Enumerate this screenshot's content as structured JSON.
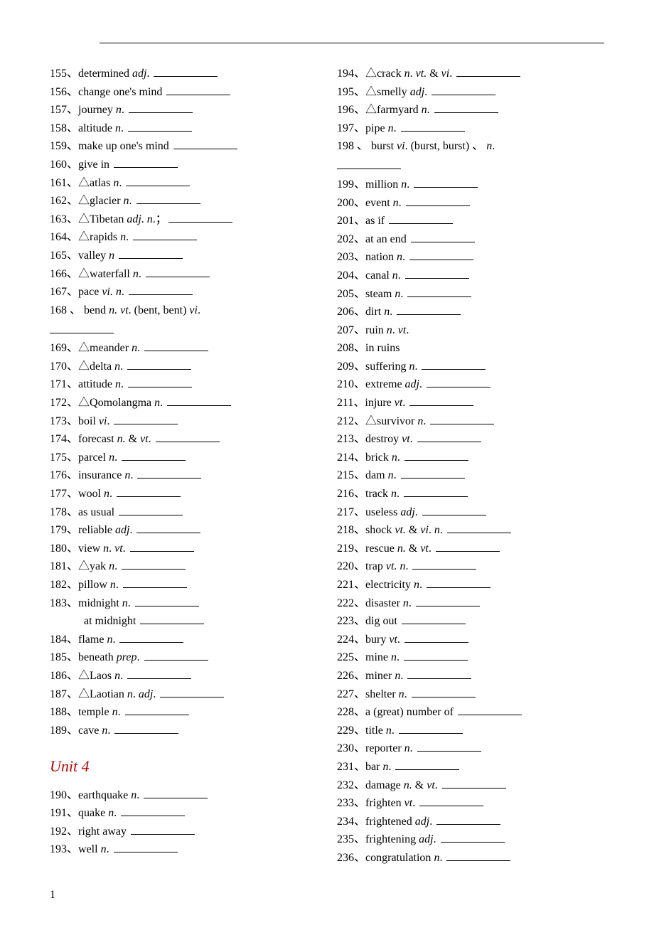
{
  "page_number": "1",
  "unit_header": "Unit 4",
  "left_col": [
    {
      "n": "155、",
      "pre": "determined ",
      "it": "adj",
      "post": ". ",
      "blank": true
    },
    {
      "n": "156、",
      "pre": "change one's mind ",
      "blank": true
    },
    {
      "n": "157、",
      "pre": "journey ",
      "it": "n",
      "post": ". ",
      "blank": true
    },
    {
      "n": "158、",
      "pre": "altitude ",
      "it": "n",
      "post": ". ",
      "blank": true
    },
    {
      "n": "159、",
      "pre": "make up one's mind ",
      "blank": true
    },
    {
      "n": "160、",
      "pre": "give in ",
      "blank": true
    },
    {
      "n": "161、",
      "pre": "△atlas ",
      "it": "n",
      "post": ". ",
      "blank": true
    },
    {
      "n": "162、",
      "pre": "△glacier ",
      "it": "n",
      "post": ". ",
      "blank": true
    },
    {
      "n": "163、",
      "pre": "△Tibetan    ",
      "it": "adj",
      "post": ".      ",
      "it2": "n",
      "post2": ".；",
      "blank": true
    },
    {
      "n": "164、",
      "pre": "△rapids ",
      "it": "n",
      "post": ". ",
      "blank": true
    },
    {
      "n": "165、",
      "pre": "valley ",
      "it": "n",
      "post": " ",
      "blank": true
    },
    {
      "n": "166、",
      "pre": "△waterfall ",
      "it": "n",
      "post": ". ",
      "blank": true
    },
    {
      "n": "167、",
      "pre": "pace ",
      "it": "vi. n",
      "post": ". ",
      "blank": true
    },
    {
      "n": "168 、 ",
      "pre": "bend  ",
      "it": "n.  vt",
      "post": ".  (bent,  bent)     ",
      "it2": "vi",
      "post2": ".",
      "blank": false,
      "cont": true
    },
    {
      "n": "169、",
      "pre": "△meander ",
      "it": "n",
      "post": ". ",
      "blank": true
    },
    {
      "n": "170、",
      "pre": "△delta ",
      "it": "n",
      "post": ". ",
      "blank": true
    },
    {
      "n": "171、",
      "pre": "attitude ",
      "it": "n",
      "post": ". ",
      "blank": true
    },
    {
      "n": "172、",
      "pre": "△Qomolangma ",
      "it": "n",
      "post": ". ",
      "blank": true
    },
    {
      "n": "173、",
      "pre": "boil ",
      "it": "vi",
      "post": ". ",
      "blank": true
    },
    {
      "n": "174、",
      "pre": "forecast ",
      "it": "n. ",
      "post": "& ",
      "it2": "vt",
      "post2": ". ",
      "blank": true
    },
    {
      "n": "175、",
      "pre": "parcel ",
      "it": "n",
      "post": ". ",
      "blank": true
    },
    {
      "n": "176、",
      "pre": "insurance ",
      "it": "n",
      "post": ". ",
      "blank": true
    },
    {
      "n": "177、",
      "pre": "wool ",
      "it": "n",
      "post": ". ",
      "blank": true
    },
    {
      "n": "178、",
      "pre": "as usual ",
      "blank": true
    },
    {
      "n": "179、",
      "pre": "reliable ",
      "it": "adj",
      "post": ". ",
      "blank": true
    },
    {
      "n": "180、",
      "pre": "view ",
      "it": "n",
      "post": ".    ",
      "it2": "vt",
      "post2": ". ",
      "blank": true
    },
    {
      "n": "181、",
      "pre": "△yak ",
      "it": "n",
      "post": ". ",
      "blank": true
    },
    {
      "n": "182、",
      "pre": "pillow ",
      "it": "n",
      "post": ". ",
      "blank": true
    },
    {
      "n": "183、",
      "pre": "midnight ",
      "it": "n",
      "post": ". ",
      "blank": true
    },
    {
      "sub": true,
      "pre": "at midnight ",
      "blank": true
    },
    {
      "n": "184、",
      "pre": "flame ",
      "it": "n",
      "post": ". ",
      "blank": true
    },
    {
      "n": "185、",
      "pre": "beneath ",
      "it": "prep",
      "post": ". ",
      "blank": true
    },
    {
      "n": "186、",
      "pre": "△Laos ",
      "it": "n",
      "post": ". ",
      "blank": true
    },
    {
      "n": "187、",
      "pre": "△Laotian   ",
      "it": "n",
      "post": ".   ",
      "it2": "adj",
      "post2": ". ",
      "blank": true
    },
    {
      "n": "188、",
      "pre": "temple ",
      "it": "n",
      "post": ". ",
      "blank": true
    },
    {
      "n": "189、",
      "pre": "cave ",
      "it": "n",
      "post": ". ",
      "blank": true
    }
  ],
  "left_col_after_unit": [
    {
      "n": "190、",
      "pre": "earthquake ",
      "it": "n",
      "post": ". ",
      "blank": true
    },
    {
      "n": "191、",
      "pre": "quake ",
      "it": "n",
      "post": ". ",
      "blank": true
    },
    {
      "n": "192、",
      "pre": "right away ",
      "blank": true
    },
    {
      "n": "193、",
      "pre": "well ",
      "it": "n",
      "post": ". ",
      "blank": true
    }
  ],
  "right_col": [
    {
      "n": "194、",
      "pre": "△crack ",
      "it": "n",
      "post": ".   ",
      "it2": "vt. ",
      "post2": "& ",
      "it3": "vi",
      "post3": ". ",
      "blank": true
    },
    {
      "n": "195、",
      "pre": "△smelly ",
      "it": "adj",
      "post": ". ",
      "blank": true
    },
    {
      "n": "196、",
      "pre": "△farmyard ",
      "it": "n",
      "post": ". ",
      "blank": true
    },
    {
      "n": "197、",
      "pre": "pipe ",
      "it": "n",
      "post": ". ",
      "blank": true
    },
    {
      "n": "198 、 ",
      "pre": "burst  ",
      "it": "vi",
      "post": ".  (burst,  burst)   、       ",
      "it2": "n",
      "post2": ".",
      "blank": false,
      "cont": true
    },
    {
      "n": "199、",
      "pre": "million ",
      "it": "n",
      "post": ". ",
      "blank": true
    },
    {
      "n": "200、",
      "pre": "event ",
      "it": "n",
      "post": ". ",
      "blank": true
    },
    {
      "n": "201、",
      "pre": "as if ",
      "blank": true
    },
    {
      "n": "202、",
      "pre": "at an end ",
      "blank": true
    },
    {
      "n": "203、",
      "pre": "nation ",
      "it": "n",
      "post": ". ",
      "blank": true
    },
    {
      "n": "204、",
      "pre": "canal ",
      "it": "n",
      "post": ". ",
      "blank": true
    },
    {
      "n": "205、",
      "pre": "steam ",
      "it": "n",
      "post": ". ",
      "blank": true
    },
    {
      "n": "206、",
      "pre": "dirt ",
      "it": "n",
      "post": ". ",
      "blank": true
    },
    {
      "n": "207、",
      "pre": "ruin ",
      "it": "n",
      "post": ".     ",
      "it2": "vt",
      "post2": ".",
      "blank": false
    },
    {
      "n": "208、",
      "pre": "in ruins",
      "blank": false
    },
    {
      "n": "209、",
      "pre": "suffering ",
      "it": "n",
      "post": ". ",
      "blank": true
    },
    {
      "n": "210、",
      "pre": "extreme ",
      "it": "adj",
      "post": ". ",
      "blank": true
    },
    {
      "n": "211、",
      "pre": "injure   ",
      "it": "vt",
      "post": ". ",
      "blank": true
    },
    {
      "n": "212、",
      "pre": "△survivor ",
      "it": "n",
      "post": ". ",
      "blank": true
    },
    {
      "n": "213、",
      "pre": "destroy   ",
      "it": "vt",
      "post": ". ",
      "blank": true
    },
    {
      "n": "214、",
      "pre": "brick ",
      "it": "n",
      "post": ". ",
      "blank": true
    },
    {
      "n": "215、",
      "pre": "dam ",
      "it": "n",
      "post": ". ",
      "blank": true
    },
    {
      "n": "216、",
      "pre": "track ",
      "it": "n",
      "post": ". ",
      "blank": true
    },
    {
      "n": "217、",
      "pre": "useless ",
      "it": "adj",
      "post": ". ",
      "blank": true
    },
    {
      "n": "218、",
      "pre": "shock   ",
      "it": "vt. ",
      "post": "& ",
      "it2": "vi",
      "post2": ".     ",
      "it3": "n",
      "post3": ". ",
      "blank": true
    },
    {
      "n": "219、",
      "pre": "rescue ",
      "it": "n. ",
      "post": "& ",
      "it2": "vt",
      "post2": ". ",
      "blank": true
    },
    {
      "n": "220、",
      "pre": "trap ",
      "it": "vt. n",
      "post": ". ",
      "blank": true
    },
    {
      "n": "221、",
      "pre": "electricity ",
      "it": "n",
      "post": ". ",
      "blank": true
    },
    {
      "n": "222、",
      "pre": "disaster ",
      "it": "n",
      "post": ". ",
      "blank": true
    },
    {
      "n": "223、",
      "pre": "dig out ",
      "blank": true
    },
    {
      "n": "224、",
      "pre": "bury ",
      "it": "vt",
      "post": ". ",
      "blank": true
    },
    {
      "n": "225、",
      "pre": "mine ",
      "it": "n",
      "post": ". ",
      "blank": true
    },
    {
      "n": "226、",
      "pre": "miner ",
      "it": "n",
      "post": ". ",
      "blank": true
    },
    {
      "n": "227、",
      "pre": "shelter ",
      "it": "n",
      "post": ". ",
      "blank": true
    },
    {
      "n": "228、",
      "pre": "a (great) number of ",
      "blank": true
    },
    {
      "n": "229、",
      "pre": "title ",
      "it": "n",
      "post": ". ",
      "blank": true
    },
    {
      "n": "230、",
      "pre": "reporter ",
      "it": "n",
      "post": ". ",
      "blank": true
    },
    {
      "n": "231、",
      "pre": "bar ",
      "it": "n",
      "post": ". ",
      "blank": true
    },
    {
      "n": "232、",
      "pre": "damage ",
      "it": "n. ",
      "post": "& ",
      "it2": "vt",
      "post2": ". ",
      "blank": true
    },
    {
      "n": "233、",
      "pre": "frighten ",
      "it": "vt",
      "post": ". ",
      "blank": true
    },
    {
      "n": "234、",
      "pre": "frightened ",
      "it": "adj",
      "post": ". ",
      "blank": true
    },
    {
      "n": "235、",
      "pre": "frightening ",
      "it": "adj",
      "post": ". ",
      "blank": true
    },
    {
      "n": "236、",
      "pre": "congratulation ",
      "it": "n",
      "post": ". ",
      "blank": true
    }
  ]
}
